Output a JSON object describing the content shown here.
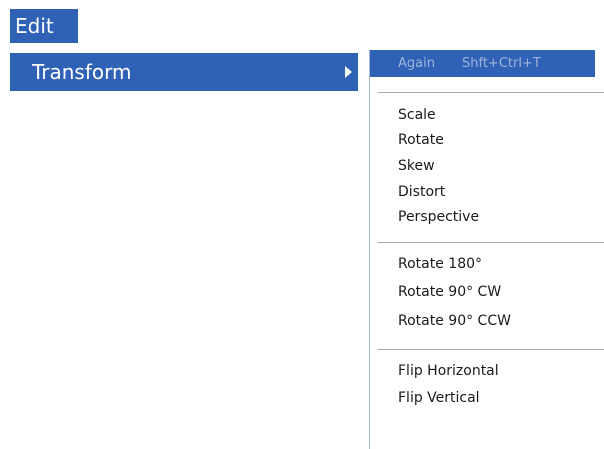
{
  "menu": {
    "title": "Edit",
    "transform_label": "Transform"
  },
  "submenu": {
    "again": {
      "label": "Again",
      "shortcut": "Shft+Ctrl+T"
    },
    "group_basic": [
      "Scale",
      "Rotate",
      "Skew",
      "Distort",
      "Perspective"
    ],
    "group_rotate": [
      "Rotate 180°",
      "Rotate 90° CW",
      "Rotate 90° CCW"
    ],
    "group_flip": [
      "Flip Horizontal",
      "Flip Vertical"
    ]
  },
  "colors": {
    "highlight": "#2f62b7",
    "disabled_text": "#9fb4d8",
    "text": "#1a1a1a"
  },
  "icons": {
    "submenu_arrow": "chevron-right-icon"
  }
}
